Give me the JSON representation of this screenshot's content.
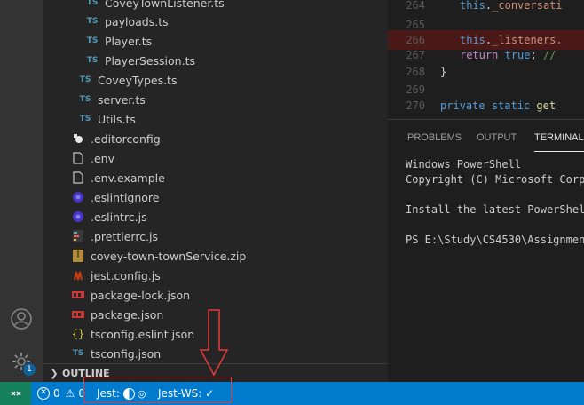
{
  "explorer": {
    "items": [
      {
        "label": "CoveyTownListener.ts",
        "icon": "typescript-icon"
      },
      {
        "label": "payloads.ts",
        "icon": "typescript-icon"
      },
      {
        "label": "Player.ts",
        "icon": "typescript-icon"
      },
      {
        "label": "PlayerSession.ts",
        "icon": "typescript-icon"
      },
      {
        "label": "CoveyTypes.ts",
        "icon": "typescript-icon"
      },
      {
        "label": "server.ts",
        "icon": "typescript-icon"
      },
      {
        "label": "Utils.ts",
        "icon": "typescript-icon"
      },
      {
        "label": ".editorconfig",
        "icon": "editorconfig-icon"
      },
      {
        "label": ".env",
        "icon": "file-icon"
      },
      {
        "label": ".env.example",
        "icon": "file-icon"
      },
      {
        "label": ".eslintignore",
        "icon": "eslint-icon"
      },
      {
        "label": ".eslintrc.js",
        "icon": "eslint-icon"
      },
      {
        "label": ".prettierrc.js",
        "icon": "prettier-icon"
      },
      {
        "label": "covey-town-townService.zip",
        "icon": "zip-icon"
      },
      {
        "label": "jest.config.js",
        "icon": "jest-icon"
      },
      {
        "label": "package-lock.json",
        "icon": "npm-icon"
      },
      {
        "label": "package.json",
        "icon": "npm-icon"
      },
      {
        "label": "tsconfig.eslint.json",
        "icon": "json-icon"
      },
      {
        "label": "tsconfig.json",
        "icon": "tsconfig-icon"
      }
    ],
    "outline_label": "OUTLINE"
  },
  "activity": {
    "badge": "1"
  },
  "editor": {
    "lines": [
      {
        "num": "264",
        "text": "this._conversati"
      },
      {
        "num": "265",
        "text": ""
      },
      {
        "num": "266",
        "text": "this._listeners."
      },
      {
        "num": "267",
        "text": "return true; //"
      },
      {
        "num": "268",
        "text": "}"
      },
      {
        "num": "269",
        "text": ""
      },
      {
        "num": "270",
        "text": "private static get"
      }
    ]
  },
  "panel": {
    "tabs": [
      "PROBLEMS",
      "OUTPUT",
      "TERMINAL"
    ],
    "active_tab": "TERMINAL",
    "terminal_lines": [
      "Windows PowerShell",
      "Copyright (C) Microsoft Corpo",
      "",
      "Install the latest PowerShell",
      "",
      "PS E:\\Study\\CS4530\\Assignment"
    ]
  },
  "statusbar": {
    "errors": "0",
    "warnings": "0",
    "jest_label": "Jest:",
    "jest_ws_label": "Jest-WS: ✓"
  },
  "colors": {
    "statusbar_bg": "#007acc",
    "remote_bg": "#16825d",
    "annotation": "#e83a3a"
  }
}
